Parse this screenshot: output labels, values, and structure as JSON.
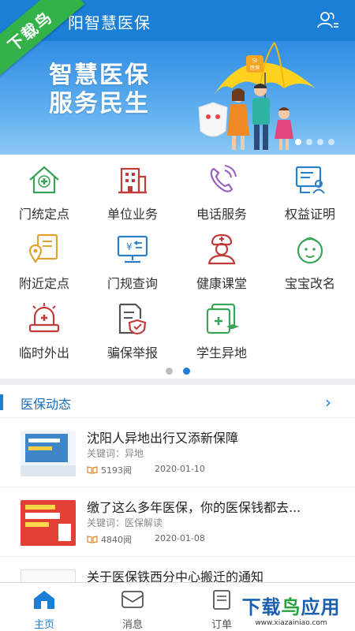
{
  "header": {
    "title": "阳智慧医保"
  },
  "ribbon": {
    "text": "下载鸟"
  },
  "banner": {
    "slogan_line1": "智慧医保",
    "slogan_line2": "服务民生",
    "umbrella_text": "SI\n医保"
  },
  "services": [
    {
      "label": "门统定点",
      "icon": "house-cross-icon"
    },
    {
      "label": "单位业务",
      "icon": "building-icon"
    },
    {
      "label": "电话服务",
      "icon": "phone-icon"
    },
    {
      "label": "权益证明",
      "icon": "certificate-user-icon"
    },
    {
      "label": "附近定点",
      "icon": "map-pin-icon"
    },
    {
      "label": "门规查询",
      "icon": "monitor-yen-icon"
    },
    {
      "label": "健康课堂",
      "icon": "nurse-icon"
    },
    {
      "label": "宝宝改名",
      "icon": "baby-icon"
    },
    {
      "label": "临时外出",
      "icon": "alarm-cross-icon"
    },
    {
      "label": "骗保举报",
      "icon": "report-shield-icon"
    },
    {
      "label": "学生异地",
      "icon": "student-card-icon"
    }
  ],
  "news": {
    "section_title": "医保动态",
    "items": [
      {
        "title": "沈阳人异地出行又添新保障",
        "keyword": "关键词：异地",
        "reads": "5193阅",
        "date": "2020-01-10"
      },
      {
        "title": "缴了这么多年医保，你的医保钱都去...",
        "keyword": "关键词：医保解读",
        "reads": "4840阅",
        "date": "2020-01-08"
      },
      {
        "title": "关于医保铁西分中心搬迁的通知",
        "keyword": "",
        "reads": "",
        "date": ""
      }
    ]
  },
  "tabs": [
    {
      "label": "主页",
      "icon": "home-icon",
      "active": true
    },
    {
      "label": "消息",
      "icon": "message-icon",
      "active": false
    },
    {
      "label": "订单",
      "icon": "order-icon",
      "active": false
    }
  ],
  "watermark": {
    "line1a": "下载",
    "line1b": "鸟",
    "line1c": "应用",
    "line2": "www.xiazainiao.com"
  },
  "colors": {
    "primary": "#1b7fd6",
    "icon_green": "#3aa35a",
    "icon_red": "#c23b3b",
    "icon_purple": "#9b5fc0",
    "icon_blue": "#2a7fc9",
    "icon_orange": "#e0a230"
  }
}
